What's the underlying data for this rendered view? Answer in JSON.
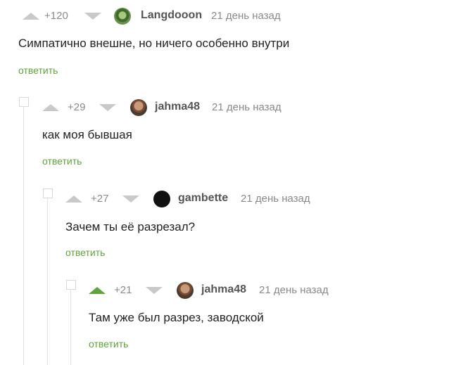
{
  "comments": [
    {
      "rating": "+120",
      "nick": "Langdooon",
      "time": "21 день назад",
      "text": "Симпатично внешне, но ничего особенно внутри",
      "reply": "ответить"
    },
    {
      "rating": "+29",
      "nick": "jahma48",
      "time": "21 день назад",
      "text": "как моя бывшая",
      "reply": "ответить"
    },
    {
      "rating": "+27",
      "nick": "gambette",
      "time": "21 день назад",
      "text": "Зачем ты её разрезал?",
      "reply": "ответить"
    },
    {
      "rating": "+21",
      "nick": "jahma48",
      "time": "21 день назад",
      "text": "Там уже был разрез, заводской",
      "reply": "ответить"
    }
  ],
  "colors": {
    "accent_green": "#5fa33a",
    "vote_gray": "#c9c9c9",
    "meta_gray": "#8a8a8a"
  }
}
